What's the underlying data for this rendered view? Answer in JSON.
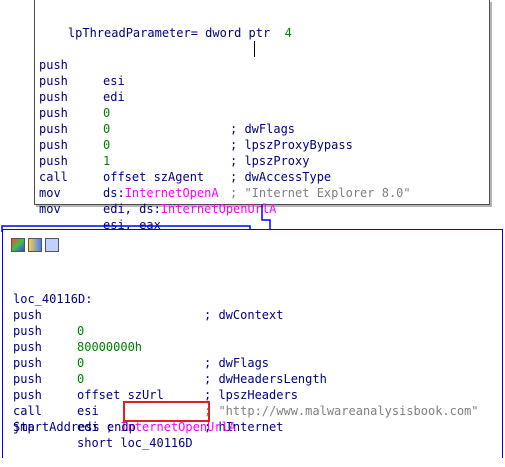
{
  "top": {
    "param_line": "lpThreadParameter= dword ptr  4",
    "lines": [
      {
        "mn": "push",
        "op": "esi",
        "cm": ""
      },
      {
        "mn": "push",
        "op": "edi",
        "cm": ""
      },
      {
        "mn": "push",
        "op": "0",
        "cm": "; dwFlags"
      },
      {
        "mn": "push",
        "op": "0",
        "cm": "; lpszProxyBypass"
      },
      {
        "mn": "push",
        "op": "0",
        "cm": "; lpszProxy"
      },
      {
        "mn": "push",
        "op": "1",
        "cm": "; dwAccessType"
      },
      {
        "mn": "push",
        "op": "offset szAgent",
        "cm": "; \"Internet Explorer 8.0\""
      },
      {
        "mn": "call",
        "op": "ds:InternetOpenA",
        "cm": ""
      },
      {
        "mn": "mov",
        "op": "edi, ds:InternetOpenUrlA",
        "cm": ""
      },
      {
        "mn": "mov",
        "op": "esi, eax",
        "cm": ""
      }
    ]
  },
  "bottom": {
    "label": "loc_40116D:",
    "label_comment": "; dwContext",
    "lines": [
      {
        "mn": "push",
        "op": "0",
        "cm": ""
      },
      {
        "mn": "push",
        "op": "80000000h",
        "cm": "; dwFlags"
      },
      {
        "mn": "push",
        "op": "0",
        "cm": "; dwHeadersLength"
      },
      {
        "mn": "push",
        "op": "0",
        "cm": "; lpszHeaders"
      },
      {
        "mn": "push",
        "op": "offset szUrl",
        "cm": "; \"http://www.malwareanalysisbook.com\""
      },
      {
        "mn": "push",
        "op": "esi",
        "cm": "; hInternet"
      },
      {
        "mn": "call",
        "op": "edi ; InternetOpenUrlA",
        "cm": ""
      },
      {
        "mn": "jmp",
        "op": "short loc_40116D",
        "cm": ""
      }
    ],
    "end_line": "StartAddress endp"
  },
  "colors": {
    "mnemonic": "#000080",
    "number": "#008000",
    "import": "#ff00ff",
    "arrow_blue": "#0000ff",
    "highlight": "#e02020"
  }
}
